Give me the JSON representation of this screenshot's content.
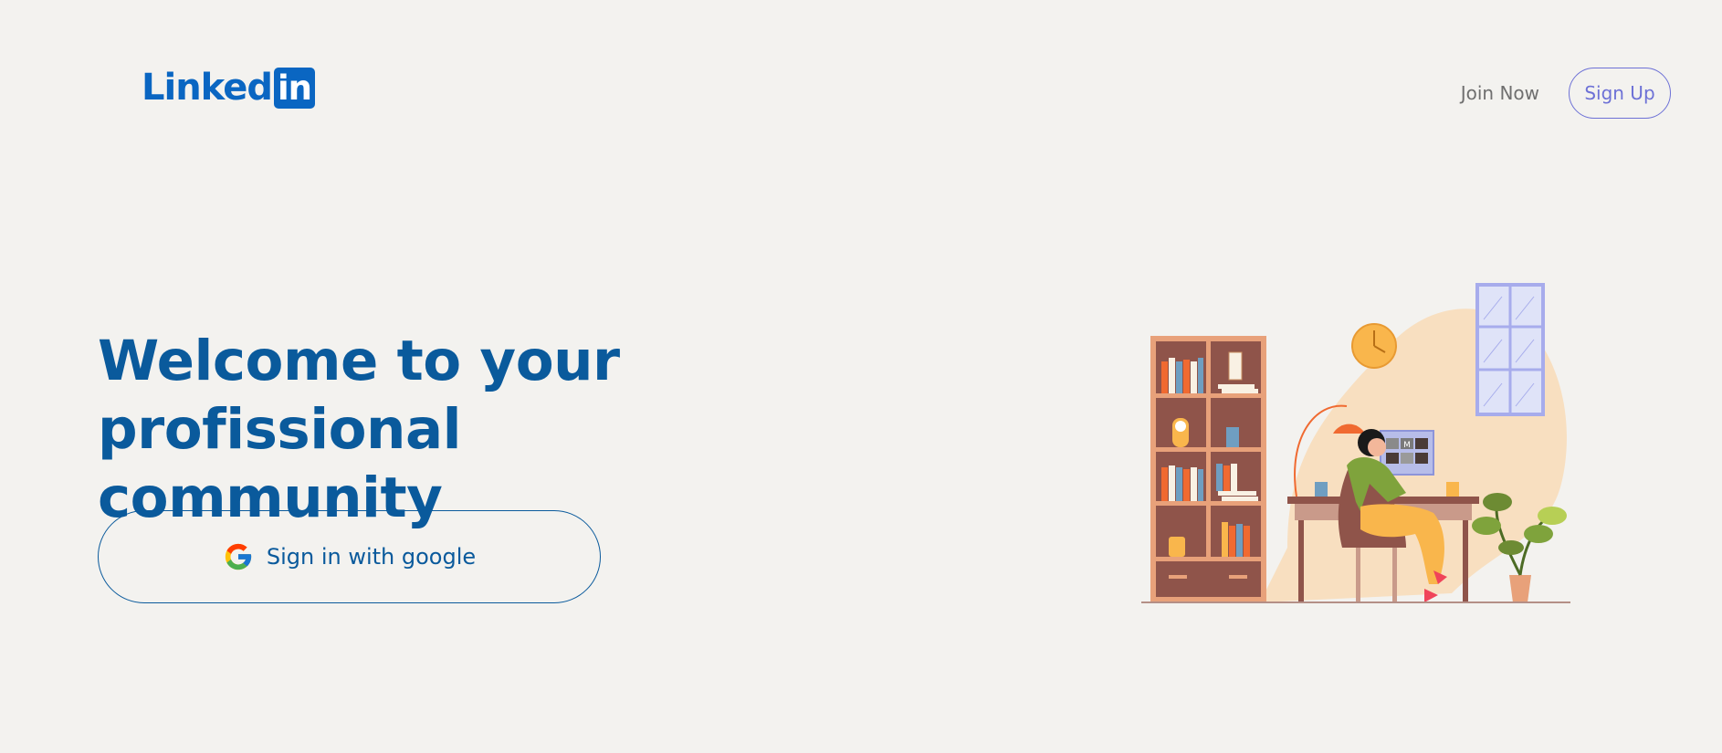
{
  "brand": {
    "logo_text": "Linked",
    "logo_box_text": "in",
    "color": "#0a66c2"
  },
  "nav": {
    "join_now": "Join Now",
    "sign_up": "Sign Up"
  },
  "hero": {
    "headline_line1": "Welcome to your profissional",
    "headline_line2": "community",
    "google_button_label": "Sign in with google",
    "google_icon": "google-g-icon"
  },
  "colors": {
    "background": "#f3f2ef",
    "headline": "#0a5a9c",
    "accent": "#6d71d6"
  },
  "illustration": {
    "monitor_letter": "M"
  }
}
